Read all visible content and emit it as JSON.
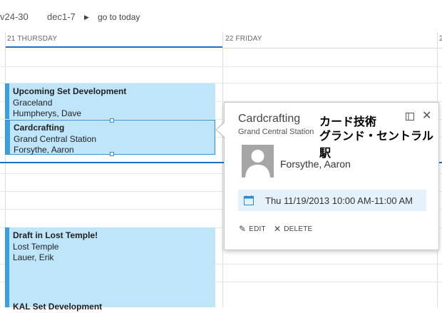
{
  "nav": {
    "prev_range": "v24-30",
    "current_range": "dec1-7",
    "arrow": "▶",
    "today": "go to today"
  },
  "days": [
    {
      "label": "21 THURSDAY"
    },
    {
      "label": "22 FRIDAY"
    },
    {
      "label": "2"
    }
  ],
  "events": [
    {
      "title": "Upcoming Set Development",
      "location": "Graceland",
      "person": "Humpherys, Dave"
    },
    {
      "title": "Cardcrafting",
      "location": "Grand Central Station",
      "person": "Forsythe, Aaron"
    },
    {
      "title": "Draft in Lost Temple!",
      "location": "Lost Temple",
      "person": "Lauer, Erik"
    },
    {
      "title": "KAL Set Development",
      "location": "",
      "person": ""
    }
  ],
  "popup": {
    "title": "Cardcrafting",
    "location": "Grand Central Station",
    "annotation_title": "カード技術",
    "annotation_location": "グランド・セントラル駅",
    "expand_icon": "expand-icon",
    "close_glyph": "✕",
    "organizer": "Forsythe, Aaron",
    "datetime": "Thu 11/19/2013 10:00 AM-11:00 AM",
    "edit_label": "EDIT",
    "delete_label": "DELETE",
    "edit_glyph": "✎",
    "delete_glyph": "✕"
  },
  "colors": {
    "accent": "#1e6fc4",
    "event_fill": "#bfe5fb",
    "event_bar": "#3aa0e0",
    "time_row": "#e6f2fb"
  }
}
